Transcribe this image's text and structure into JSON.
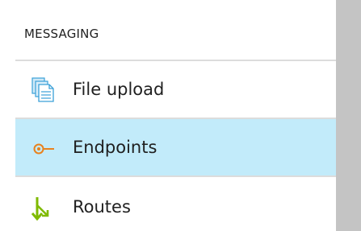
{
  "section": {
    "title": "MESSAGING"
  },
  "items": [
    {
      "label": "File upload",
      "icon": "file-upload-icon",
      "selected": false
    },
    {
      "label": "Endpoints",
      "icon": "endpoints-icon",
      "selected": true
    },
    {
      "label": "Routes",
      "icon": "routes-icon",
      "selected": false
    }
  ],
  "colors": {
    "selected_background": "#c2ebfa",
    "divider": "#dcdcdc",
    "scrollbar": "#c4c4c4",
    "file_icon": "#3aa0d8",
    "endpoint_icon": "#e8821e",
    "routes_icon": "#7fba00"
  }
}
